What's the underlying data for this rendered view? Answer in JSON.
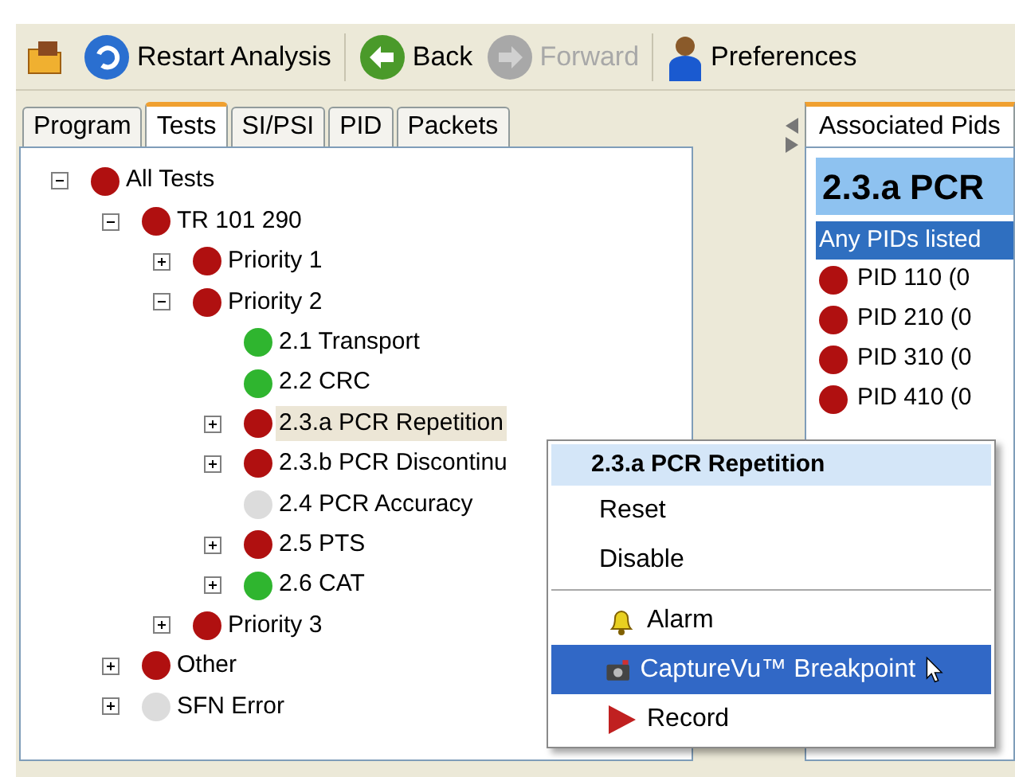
{
  "toolbar": [
    {
      "kind": "folder"
    },
    {
      "kind": "restart",
      "label": "Restart Analysis",
      "disabled": false
    },
    {
      "kind": "back",
      "label": "Back",
      "disabled": false
    },
    {
      "kind": "forward",
      "label": "Forward",
      "disabled": true
    },
    {
      "kind": "prefs",
      "label": "Preferences",
      "disabled": false
    }
  ],
  "tabs": [
    {
      "label": "Program",
      "selected": false
    },
    {
      "label": "Tests",
      "selected": true
    },
    {
      "label": "SI/PSI",
      "selected": false
    },
    {
      "label": "PID",
      "selected": false
    },
    {
      "label": "Packets",
      "selected": false
    }
  ],
  "tree": [
    {
      "label": "All Tests",
      "color": "#b01010",
      "expanded": true,
      "selected": false,
      "children": [
        {
          "label": "TR 101 290",
          "color": "#b01010",
          "expanded": true,
          "selected": false,
          "children": [
            {
              "label": "Priority 1",
              "color": "#b01010",
              "expanded": false,
              "selected": false
            },
            {
              "label": "Priority 2",
              "color": "#b01010",
              "expanded": true,
              "selected": false,
              "children": [
                {
                  "label": "2.1 Transport",
                  "color": "#2fb52f",
                  "selected": false
                },
                {
                  "label": "2.2 CRC",
                  "color": "#2fb52f",
                  "selected": false
                },
                {
                  "label": "2.3.a PCR Repetition",
                  "color": "#b01010",
                  "expanded": false,
                  "selected": true
                },
                {
                  "label": "2.3.b PCR Discontinu",
                  "color": "#b01010",
                  "expanded": false,
                  "selected": false
                },
                {
                  "label": "2.4 PCR Accuracy",
                  "color": "#dcdcdc",
                  "selected": false
                },
                {
                  "label": "2.5 PTS",
                  "color": "#b01010",
                  "expanded": false,
                  "selected": false
                },
                {
                  "label": "2.6 CAT",
                  "color": "#2fb52f",
                  "expanded": false,
                  "selected": false
                }
              ]
            },
            {
              "label": "Priority 3",
              "color": "#b01010",
              "expanded": false,
              "selected": false
            }
          ]
        },
        {
          "label": "Other",
          "color": "#b01010",
          "expanded": false,
          "selected": false
        },
        {
          "label": "SFN Error",
          "color": "#dcdcdc",
          "expanded": false,
          "selected": false
        }
      ]
    }
  ],
  "right_panel": {
    "tab": "Associated Pids",
    "title": "2.3.a PCR",
    "subtitle": "Any PIDs listed",
    "pids": [
      {
        "label": "PID 110 (0",
        "color": "#b01010"
      },
      {
        "label": "PID 210 (0",
        "color": "#b01010"
      },
      {
        "label": "PID 310 (0",
        "color": "#b01010"
      },
      {
        "label": "PID 410 (0",
        "color": "#b01010"
      }
    ]
  },
  "context_menu": {
    "title": "2.3.a PCR Repetition",
    "items": [
      {
        "kind": "item",
        "label": "Reset",
        "selected": false
      },
      {
        "kind": "item",
        "label": "Disable",
        "selected": false
      },
      {
        "kind": "separator"
      },
      {
        "kind": "alarm",
        "label": "Alarm",
        "selected": false
      },
      {
        "kind": "capture",
        "label": "CaptureVu™ Breakpoint",
        "selected": true
      },
      {
        "kind": "record",
        "label": "Record",
        "selected": false
      }
    ]
  }
}
